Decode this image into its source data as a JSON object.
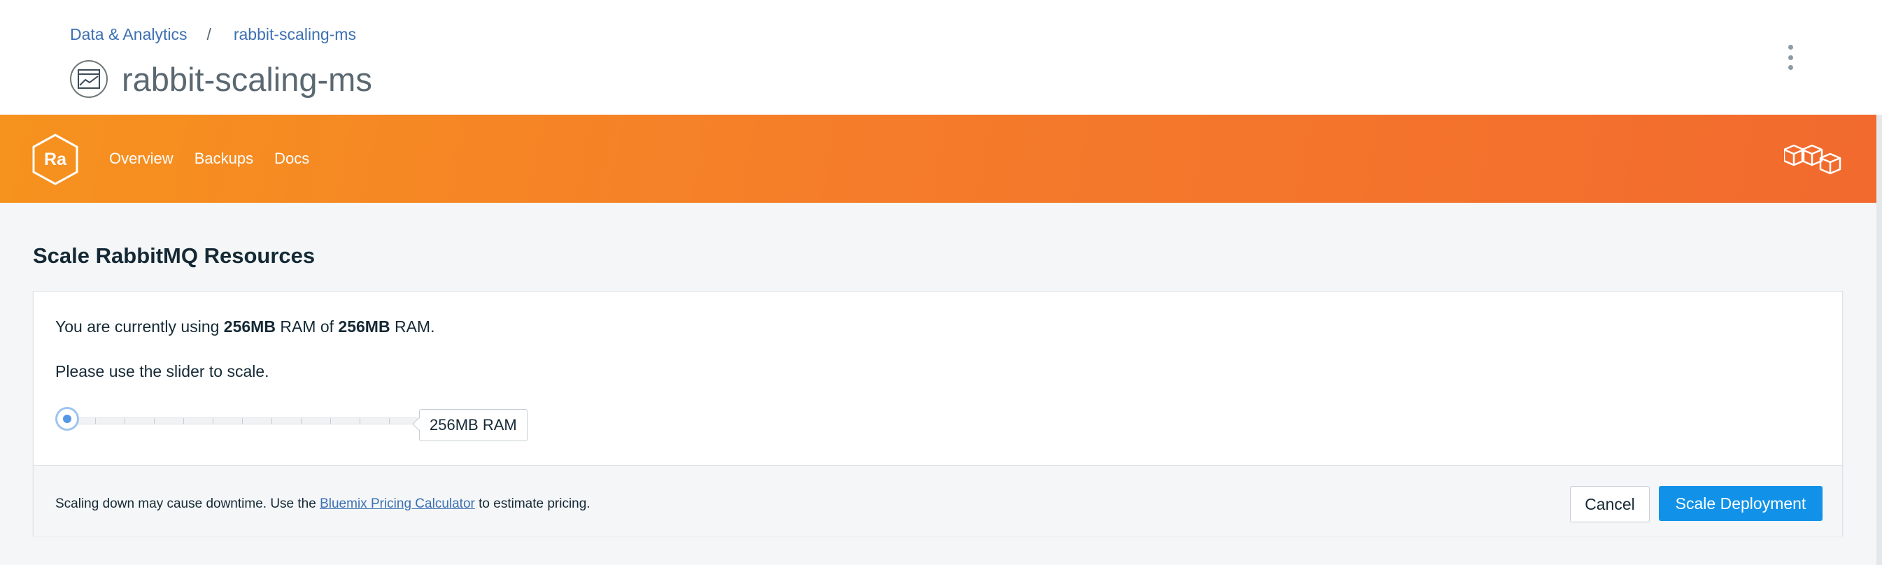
{
  "breadcrumb": {
    "items": [
      {
        "label": "Data & Analytics"
      },
      {
        "label": "rabbit-scaling-ms"
      }
    ],
    "separator": "/"
  },
  "header": {
    "title": "rabbit-scaling-ms",
    "service_icon": "chart-window-icon",
    "overflow_icon": "vertical-ellipsis-icon"
  },
  "banner": {
    "badge_text": "Ra",
    "nav": [
      {
        "label": "Overview"
      },
      {
        "label": "Backups"
      },
      {
        "label": "Docs"
      }
    ],
    "logo_icon": "cubes-logo-icon",
    "colors": {
      "start": "#f6921e",
      "end": "#f26a2e"
    }
  },
  "scale": {
    "section_title": "Scale RabbitMQ Resources",
    "usage": {
      "prefix": "You are currently using ",
      "used": "256MB",
      "middle": " RAM of ",
      "total": "256MB",
      "suffix": " RAM."
    },
    "hint": "Please use the slider to scale.",
    "slider": {
      "value_label": "256MB RAM",
      "position_fraction": 0.0
    },
    "footer": {
      "text_before": "Scaling down may cause downtime. Use the ",
      "link": "Bluemix Pricing Calculator",
      "text_after": " to estimate pricing."
    },
    "buttons": {
      "cancel": "Cancel",
      "scale": "Scale Deployment"
    },
    "colors": {
      "primary": "#1192e8",
      "link": "#3d70b2"
    }
  }
}
